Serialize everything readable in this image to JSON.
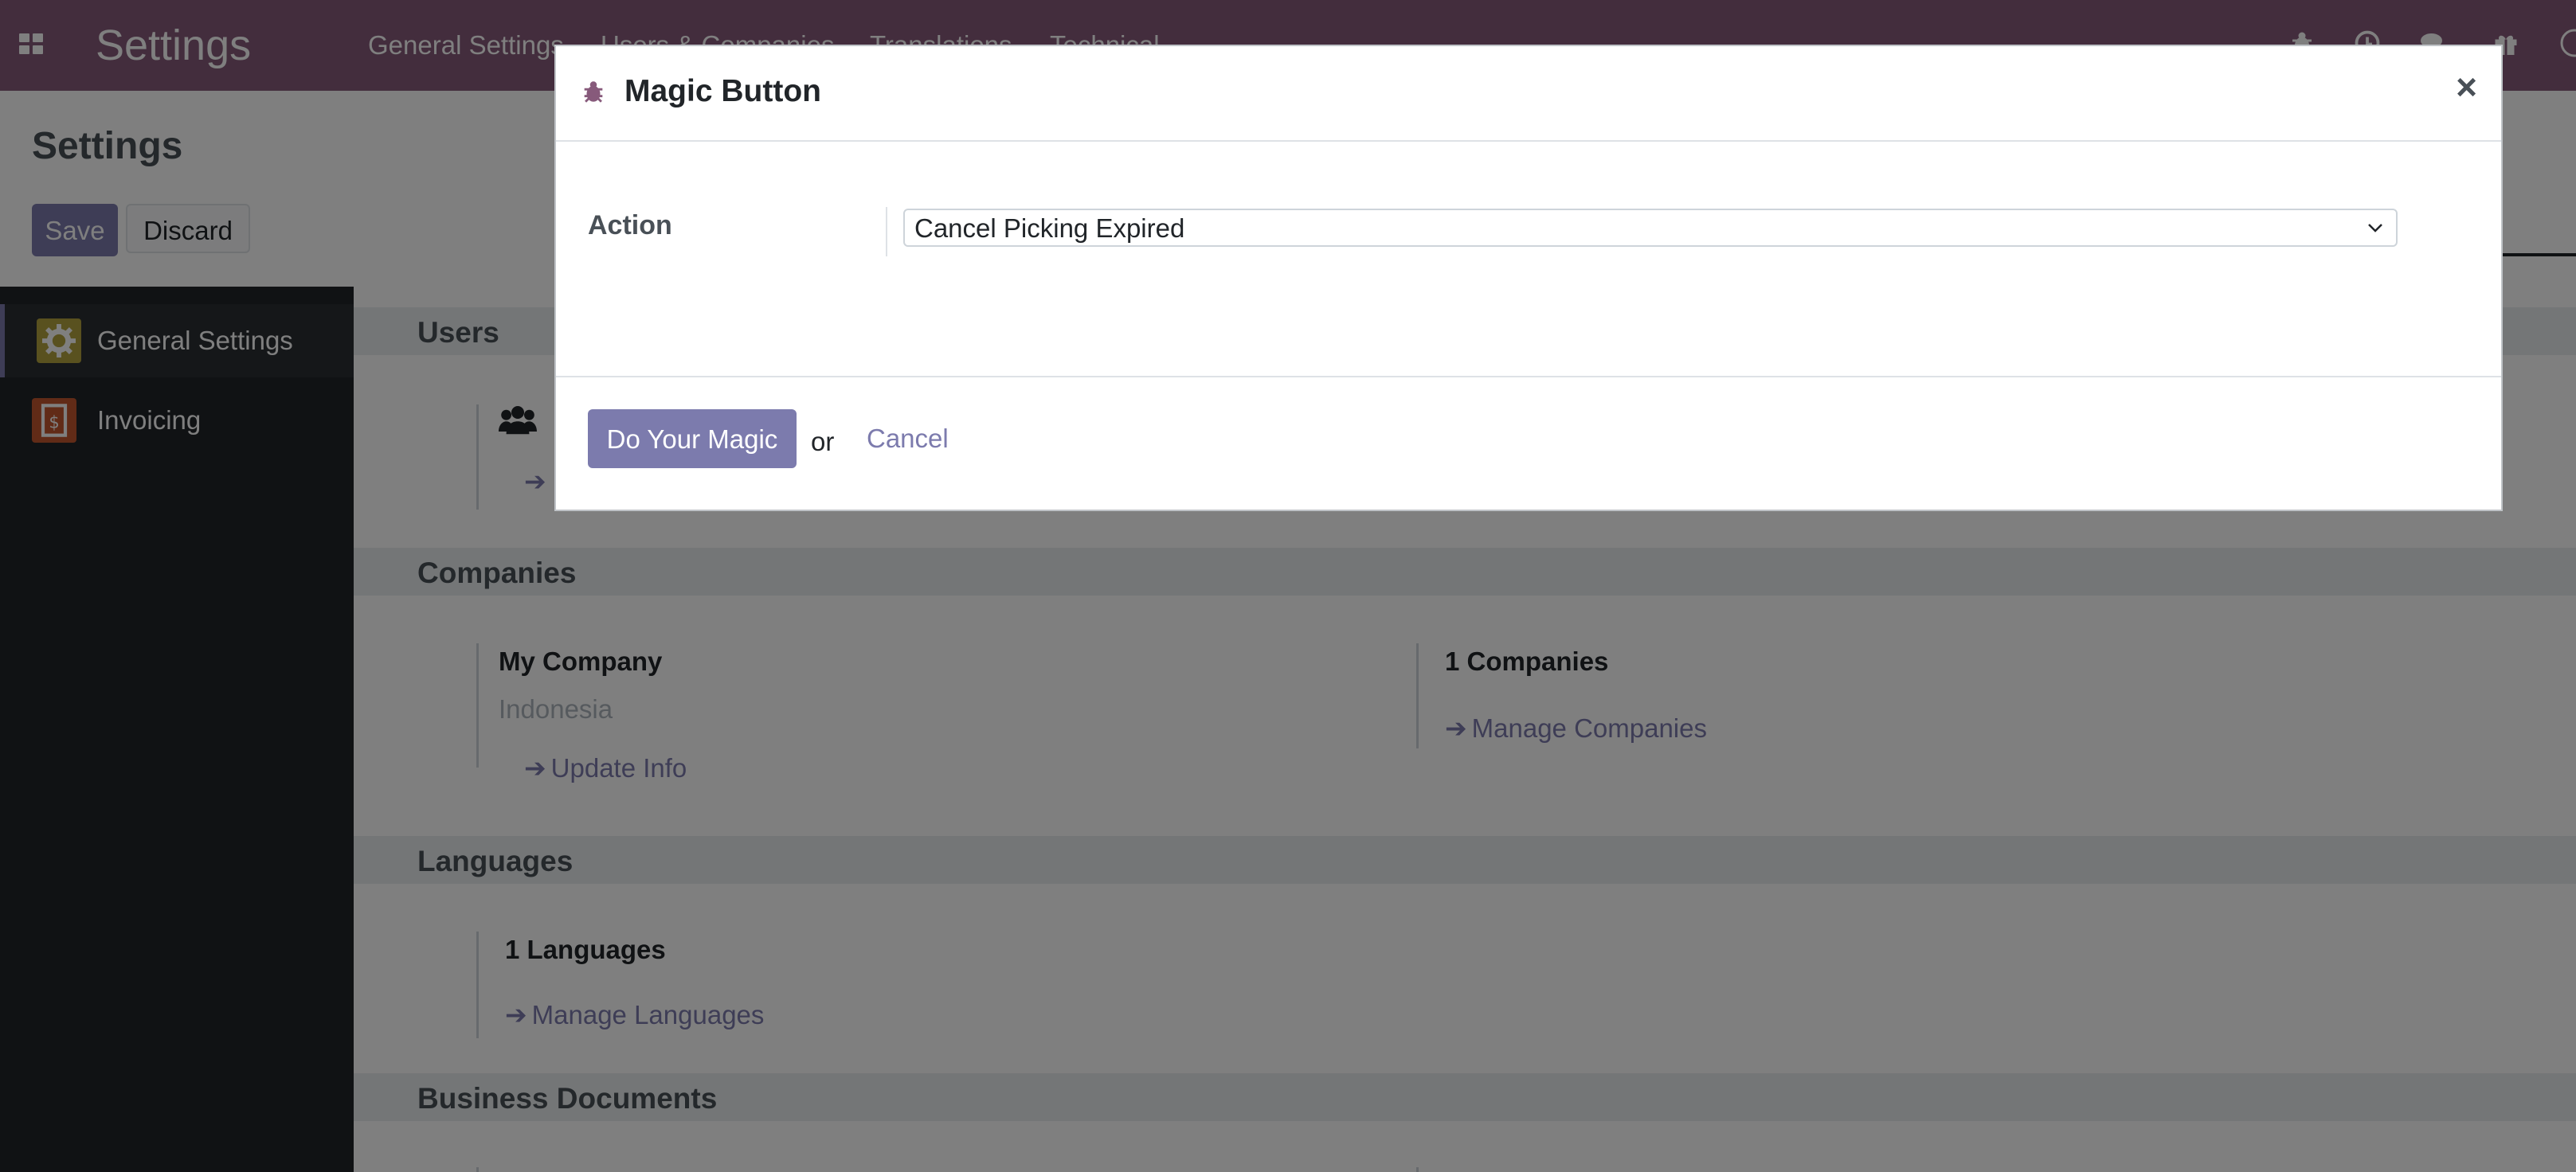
{
  "navbar": {
    "brand": "Settings",
    "menu": [
      "General Settings",
      "Users & Companies",
      "Translations",
      "Technical"
    ],
    "icons": [
      "bug-icon",
      "clock-icon",
      "chat-icon",
      "gift-icon",
      "user-avatar"
    ]
  },
  "control_panel": {
    "title": "Settings",
    "save_label": "Save",
    "discard_label": "Discard"
  },
  "sidebar": {
    "items": [
      {
        "label": "General Settings",
        "icon": "gear-icon",
        "color": "#b3a23e"
      },
      {
        "label": "Invoicing",
        "icon": "invoice-icon",
        "color": "#c2562f"
      }
    ]
  },
  "content": {
    "users": {
      "title": "Users"
    },
    "companies": {
      "title": "Companies",
      "company_name": "My Company",
      "company_country": "Indonesia",
      "update_info": "Update Info",
      "count_label": "1 Companies",
      "manage": "Manage Companies"
    },
    "languages": {
      "title": "Languages",
      "count_label": "1 Languages",
      "manage": "Manage Languages"
    },
    "business_documents": {
      "title": "Business Documents"
    }
  },
  "modal": {
    "title": "Magic Button",
    "close_glyph": "×",
    "action_label": "Action",
    "action_value": "Cancel Picking Expired",
    "primary_label": "Do Your Magic",
    "or_text": "or",
    "cancel_label": "Cancel"
  },
  "colors": {
    "brand": "#875a7b",
    "primary_button": "#7c7bad",
    "sidebar_bg": "#212529"
  }
}
